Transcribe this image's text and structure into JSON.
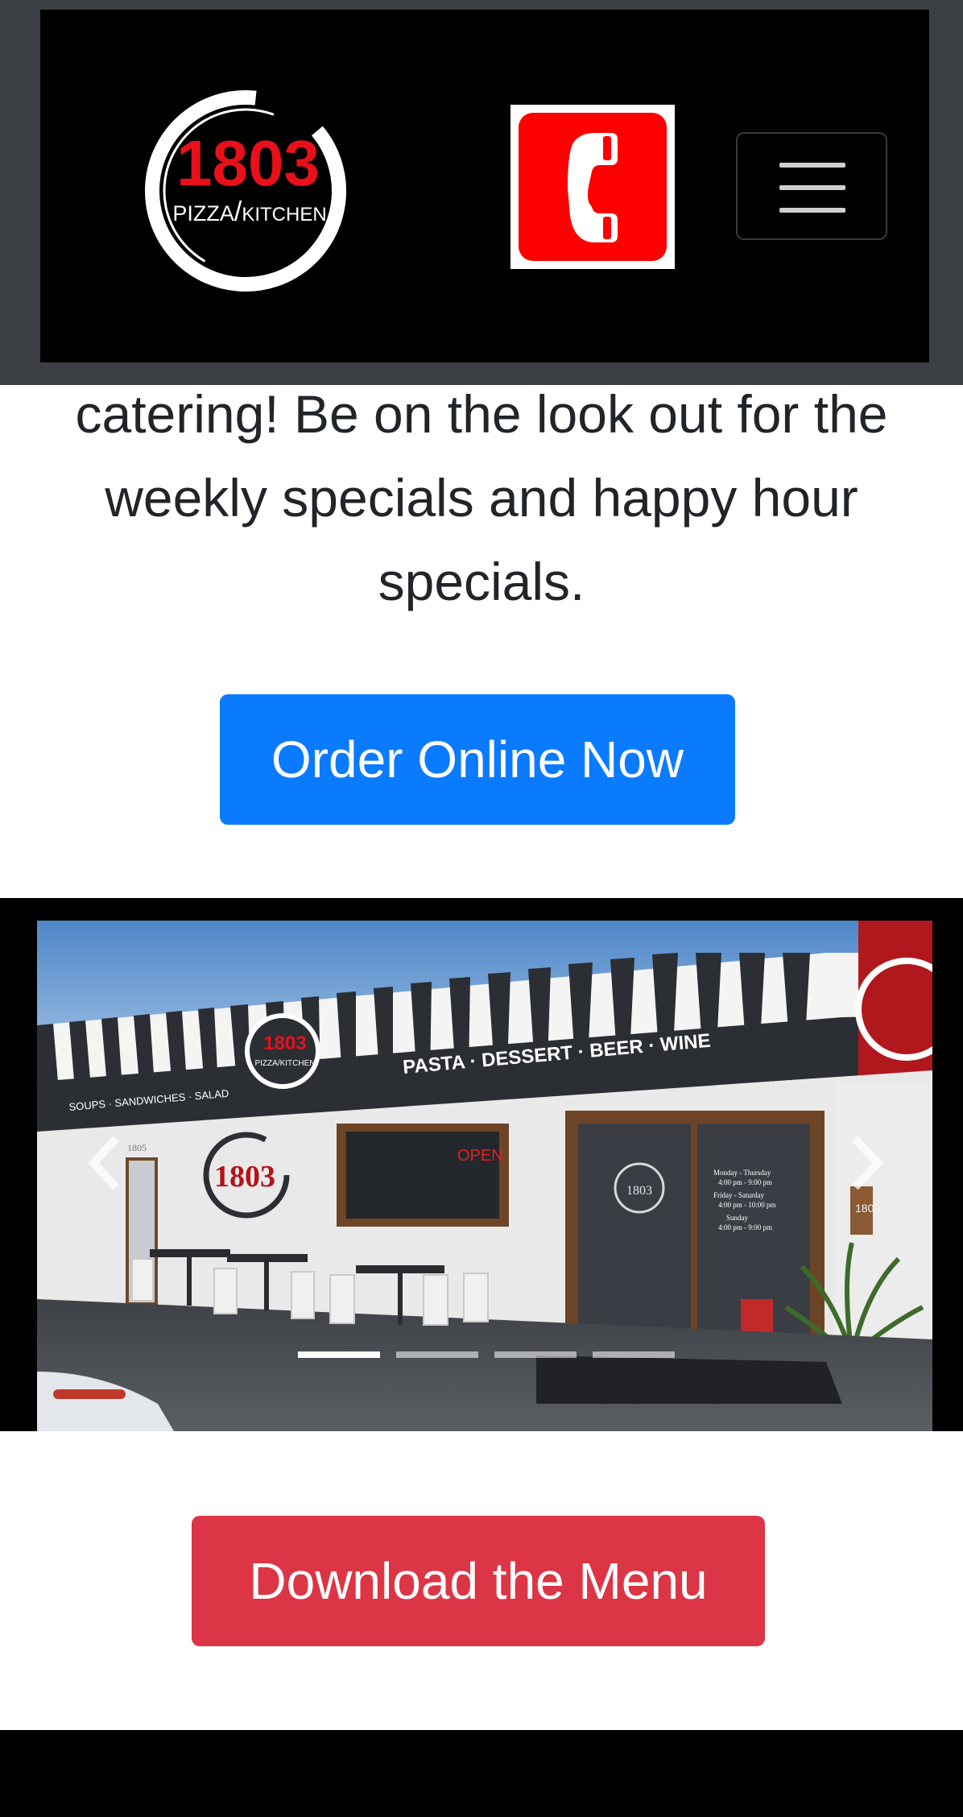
{
  "header": {
    "logo": {
      "number": "1803",
      "text_left": "PIZZA",
      "slash": "/",
      "text_right": "KITCHEN",
      "accent_color": "#e8101a"
    },
    "phone_icon": "phone-icon",
    "menu_icon": "hamburger-menu-icon"
  },
  "intro": {
    "line1": "catering! Be on the look out for the",
    "line2": "weekly specials and happy hour",
    "line3": "specials."
  },
  "cta": {
    "order_label": "Order Online Now",
    "order_color": "#0a7bff",
    "menu_label": "Download the Menu",
    "menu_color": "#dc3545"
  },
  "carousel": {
    "slide_count": 4,
    "active_index": 0,
    "awning_left": "SOUPS · SANDWICHES · SALAD",
    "awning_right": "PASTA · DESSERT · BEER · WINE",
    "building_number": "1805",
    "logo_number": "1803",
    "logo_text": "PIZZA/KITCHEN",
    "open_sign": "OPEN",
    "door_hours": [
      "Monday - Thursday",
      "4:00 pm - 9:00 pm",
      "Friday - Saturday",
      "4:00 pm - 10:00 pm",
      "Sunday",
      "4:00 pm - 9:00 pm"
    ],
    "wall_number": "1803"
  }
}
